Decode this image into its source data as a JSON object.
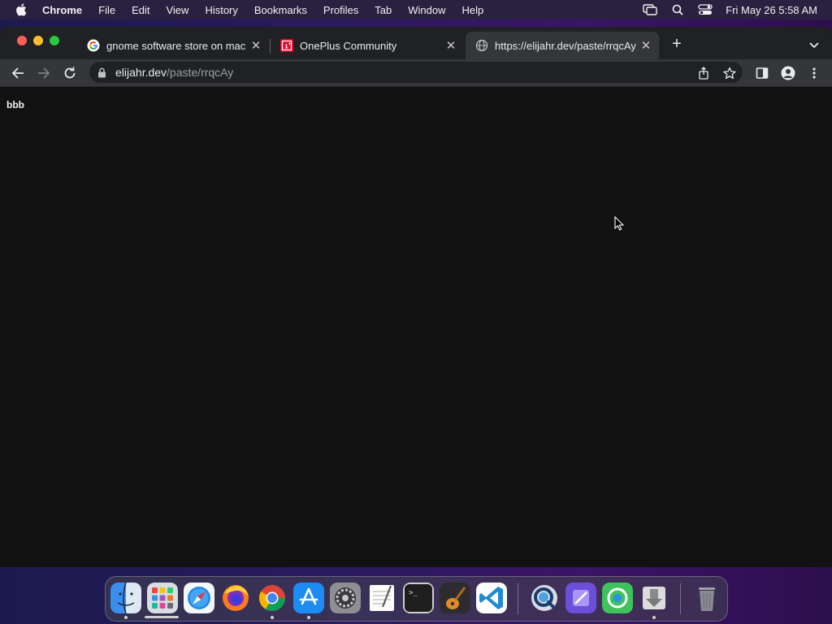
{
  "menubar": {
    "app_name": "Chrome",
    "items": [
      "File",
      "Edit",
      "View",
      "History",
      "Bookmarks",
      "Profiles",
      "Tab",
      "Window",
      "Help"
    ],
    "clock": "Fri May 26  5:58 AM"
  },
  "tabs": [
    {
      "title": "gnome software store on mac",
      "favicon": "google-icon",
      "active": false
    },
    {
      "title": "OnePlus Community",
      "favicon": "oneplus-icon",
      "active": false
    },
    {
      "title": "https://elijahr.dev/paste/rrqcAy",
      "favicon": "globe-icon",
      "active": true
    }
  ],
  "address_bar": {
    "host": "elijahr.dev",
    "path": "/paste/rrqcAy"
  },
  "page": {
    "text": "bbb"
  },
  "dock": {
    "apps": [
      "Finder",
      "Launchpad",
      "Safari",
      "Firefox",
      "Google Chrome",
      "App Store",
      "System Preferences",
      "TextEdit",
      "Terminal",
      "GarageBand",
      "Visual Studio Code",
      "QuickTime",
      "Xcode",
      "Find My",
      "Installer",
      "Trash"
    ]
  },
  "colors": {
    "tabstrip_bg": "#202124",
    "toolbar_bg": "#35363a",
    "content_bg": "#111111",
    "accent_red": "#ff5f57",
    "accent_yellow": "#febc2e",
    "accent_green": "#28c840"
  }
}
